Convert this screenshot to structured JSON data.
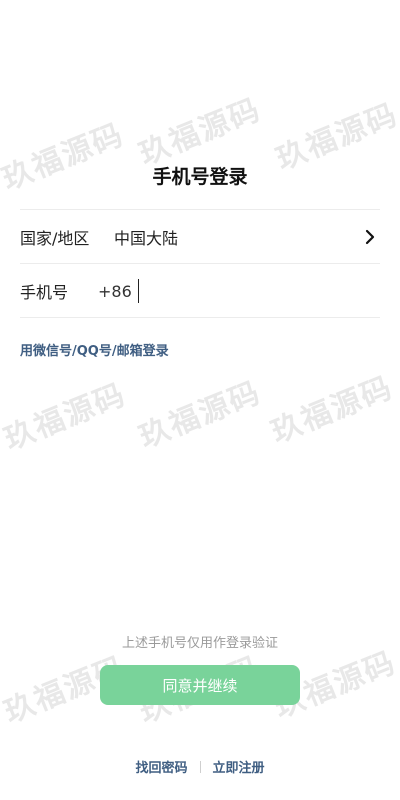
{
  "watermark_text": "玖福源码",
  "title": "手机号登录",
  "region": {
    "label": "国家/地区",
    "value": "中国大陆"
  },
  "phone": {
    "label": "手机号",
    "country_code": "+86",
    "value": "",
    "placeholder": ""
  },
  "alt_login_label": "用微信号/QQ号/邮箱登录",
  "disclaimer": "上述手机号仅用作登录验证",
  "continue_button_label": "同意并继续",
  "footer": {
    "recover_password": "找回密码",
    "register": "立即注册"
  },
  "colors": {
    "primary_button": "#79d39a",
    "link": "#3f5e82",
    "muted_text": "#9a9a9a"
  }
}
